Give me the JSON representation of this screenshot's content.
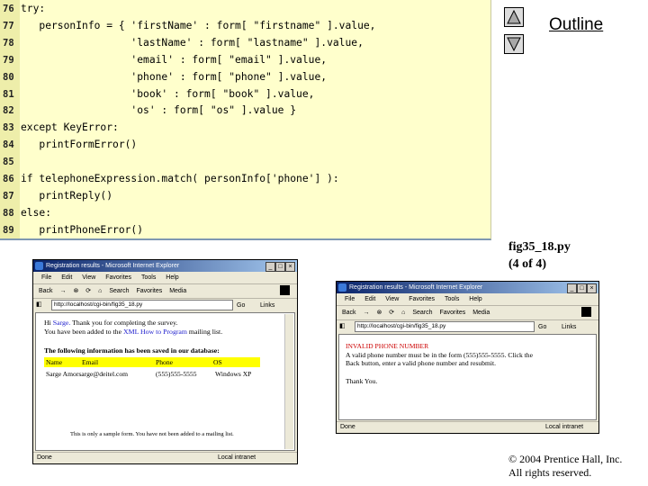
{
  "code": {
    "lines": [
      {
        "num": "76",
        "text": "try:"
      },
      {
        "num": "77",
        "text": "   personInfo = { 'firstName' : form[ \"firstname\" ].value,"
      },
      {
        "num": "78",
        "text": "                  'lastName' : form[ \"lastname\" ].value,"
      },
      {
        "num": "79",
        "text": "                  'email' : form[ \"email\" ].value,"
      },
      {
        "num": "80",
        "text": "                  'phone' : form[ \"phone\" ].value,"
      },
      {
        "num": "81",
        "text": "                  'book' : form[ \"book\" ].value,"
      },
      {
        "num": "82",
        "text": "                  'os' : form[ \"os\" ].value }"
      },
      {
        "num": "83",
        "text": "except KeyError:"
      },
      {
        "num": "84",
        "text": "   printFormError()"
      },
      {
        "num": "85",
        "text": ""
      },
      {
        "num": "86",
        "text": "if telephoneExpression.match( personInfo['phone'] ):"
      },
      {
        "num": "87",
        "text": "   printReply()"
      },
      {
        "num": "88",
        "text": "else:"
      },
      {
        "num": "89",
        "text": "   printPhoneError()"
      }
    ]
  },
  "nav": {
    "up_icon": "triangle-up-icon",
    "down_icon": "triangle-down-icon",
    "outline_label": "Outline"
  },
  "caption": {
    "line1": "fig35_18.py",
    "line2": "(4 of 4)"
  },
  "copyright": {
    "line1": "© 2004 Prentice Hall, Inc.",
    "line2": "All rights reserved."
  },
  "browser1": {
    "title": "Registration results - Microsoft Internet Explorer",
    "menu": [
      "File",
      "Edit",
      "View",
      "Favorites",
      "Tools",
      "Help"
    ],
    "toolbar": [
      "Back",
      "→",
      "⊗",
      "⟳",
      "⌂",
      "Search",
      "Favorites",
      "Media"
    ],
    "address": "http://localhost/cgi-bin/fig35_18.py",
    "go_label": "Go",
    "links_label": "Links",
    "greeting_hi": "Hi",
    "greeting_name": "Sarge.",
    "greeting_rest": "Thank you for completing the survey.",
    "added_text": "You have been added to the",
    "added_link": "XML How to Program",
    "added_tail": "mailing list.",
    "saved_heading": "The following information has been saved in our database:",
    "table_headers": [
      "Name",
      "Email",
      "Phone",
      "OS"
    ],
    "table_row": [
      "Sarge Amorsarge@deitel.com",
      "(555)555-5555",
      "Windows XP"
    ],
    "footer_note": "This is only a sample form. You have not been added to a mailing list.",
    "status_left": "Done",
    "status_right": "Local intranet"
  },
  "browser2": {
    "title": "Registration results - Microsoft Internet Explorer",
    "menu": [
      "File",
      "Edit",
      "View",
      "Favorites",
      "Tools",
      "Help"
    ],
    "toolbar": [
      "Back",
      "→",
      "⊗",
      "⟳",
      "⌂",
      "Search",
      "Favorites",
      "Media"
    ],
    "address": "http://localhost/cgi-bin/fig35_18.py",
    "go_label": "Go",
    "links_label": "Links",
    "error_heading": "INVALID PHONE NUMBER",
    "error_line1": "A valid phone number must be in the form (555)555-5555. Click the",
    "error_line2": "Back button, enter a valid phone number and resubmit.",
    "thanks": "Thank You.",
    "status_left": "Done",
    "status_right": "Local intranet"
  },
  "colors": {
    "code_bg": "#ffffcc",
    "highlight": "#ffff00",
    "error_red": "#cc0000",
    "link_blue": "#1a1acc",
    "titlebar_start": "#0a246a"
  }
}
